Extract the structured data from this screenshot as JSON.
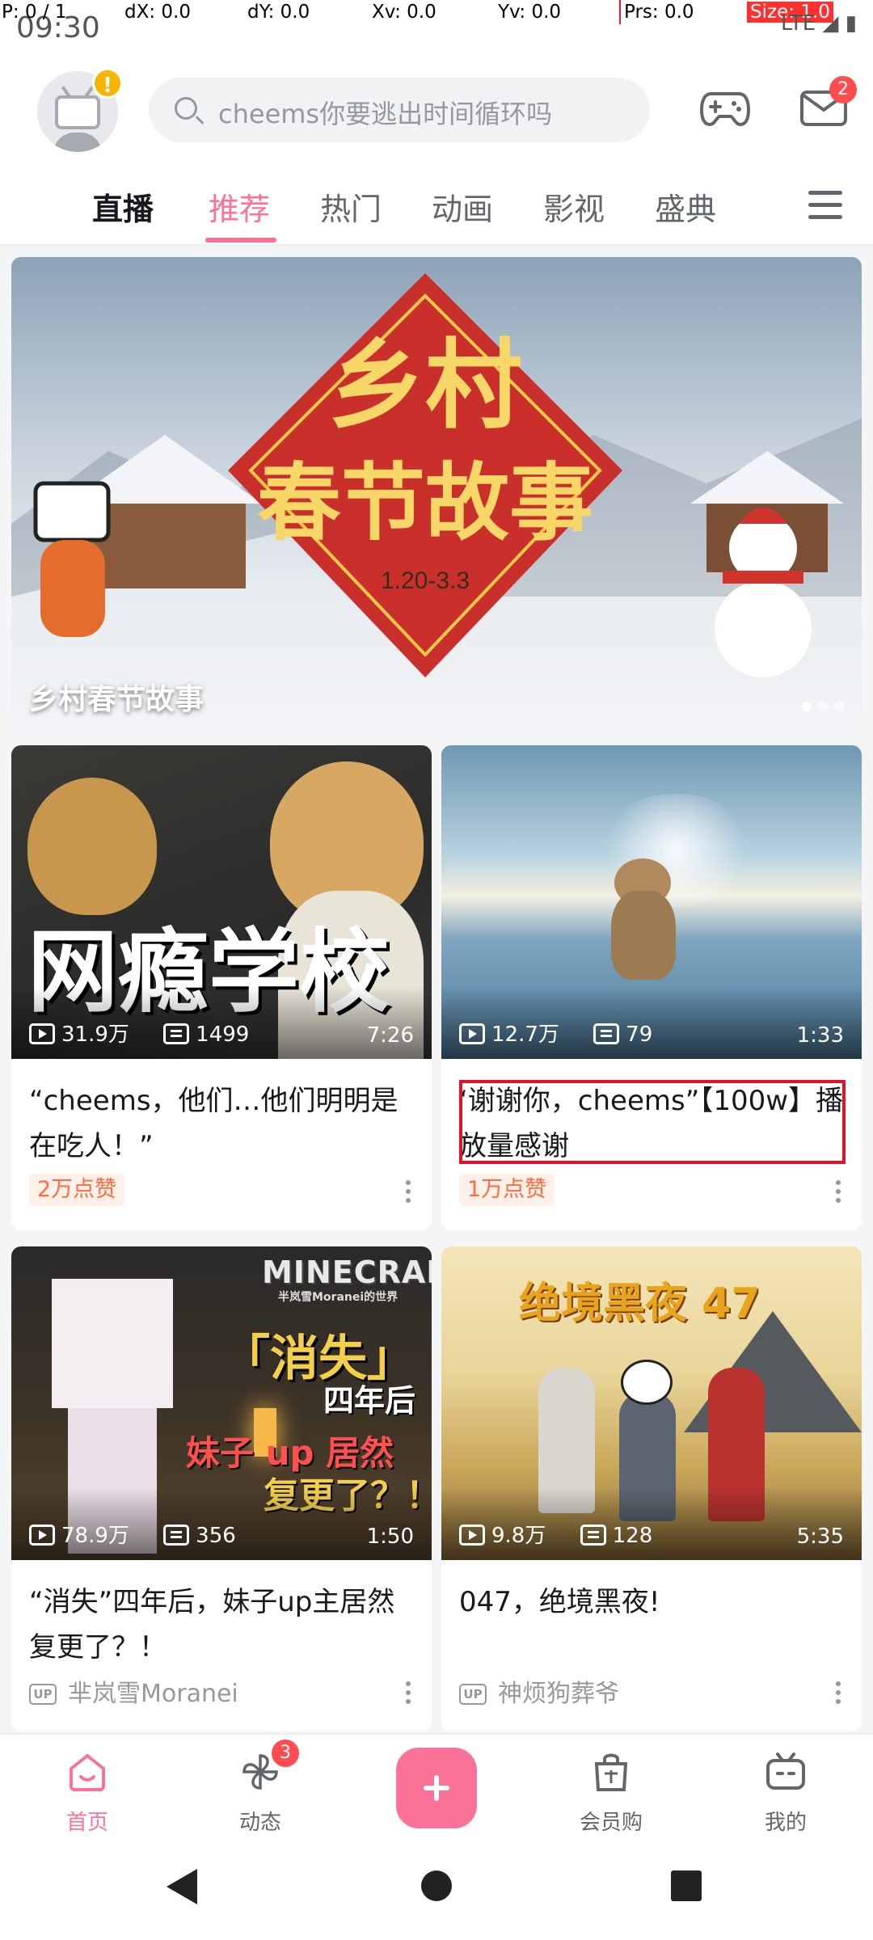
{
  "debug": {
    "p": "P: 0 / 1",
    "dx": "dX: 0.0",
    "dy": "dY: 0.0",
    "xv": "Xv: 0.0",
    "yv": "Yv: 0.0",
    "prs": "Prs: 0.0",
    "size": "Size: 1.0"
  },
  "status": {
    "time": "09:30",
    "network": "LTE"
  },
  "header": {
    "avatar_badge": "!",
    "search_placeholder": "cheems你要逃出时间循环吗",
    "mail_badge": "2"
  },
  "tabs": [
    "直播",
    "推荐",
    "热门",
    "动画",
    "影视",
    "盛典"
  ],
  "active_tab": "推荐",
  "banner": {
    "title": "乡村春节故事",
    "art_title_1": "乡村",
    "art_title_2": "春节故事",
    "art_date": "1.20-3.3"
  },
  "cards": [
    {
      "thumb_text": "网瘾学校",
      "views": "31.9万",
      "danmaku": "1499",
      "duration": "7:26",
      "title": "“cheems，他们…他们明明是在吃人！”",
      "tag": "2万点赞"
    },
    {
      "thumb_text": "",
      "views": "12.7万",
      "danmaku": "79",
      "duration": "1:33",
      "title": "‘谢谢你，cheems”【100w】播放量感谢",
      "tag": "1万点赞"
    },
    {
      "thumb_text": "MINECRAFT",
      "thumb_sub": "半岚雪Moranei的世界",
      "thumb_text_2": "「消失」",
      "thumb_text_3": "四年后",
      "thumb_text_4": "妹子 up 居然",
      "thumb_text_5": "复更了？！",
      "views": "78.9万",
      "danmaku": "356",
      "duration": "1:50",
      "title": "“消失”四年后，妹子up主居然复更了？！",
      "up_badge": "UP",
      "author": "芈岚雪Moranei"
    },
    {
      "thumb_text": "绝境黑夜 47",
      "views": "9.8万",
      "danmaku": "128",
      "duration": "5:35",
      "title": "047，绝境黑夜!",
      "up_badge": "UP",
      "author": "神烦狗葬爷"
    }
  ],
  "bottom_nav": {
    "home": "首页",
    "dynamic": "动态",
    "dynamic_badge": "3",
    "vip_shop": "会员购",
    "mine": "我的"
  },
  "colors": {
    "accent": "#fb7299",
    "badge": "#ff4d4f",
    "tag_text": "#ff6b3b",
    "highlight": "#e0152a"
  }
}
